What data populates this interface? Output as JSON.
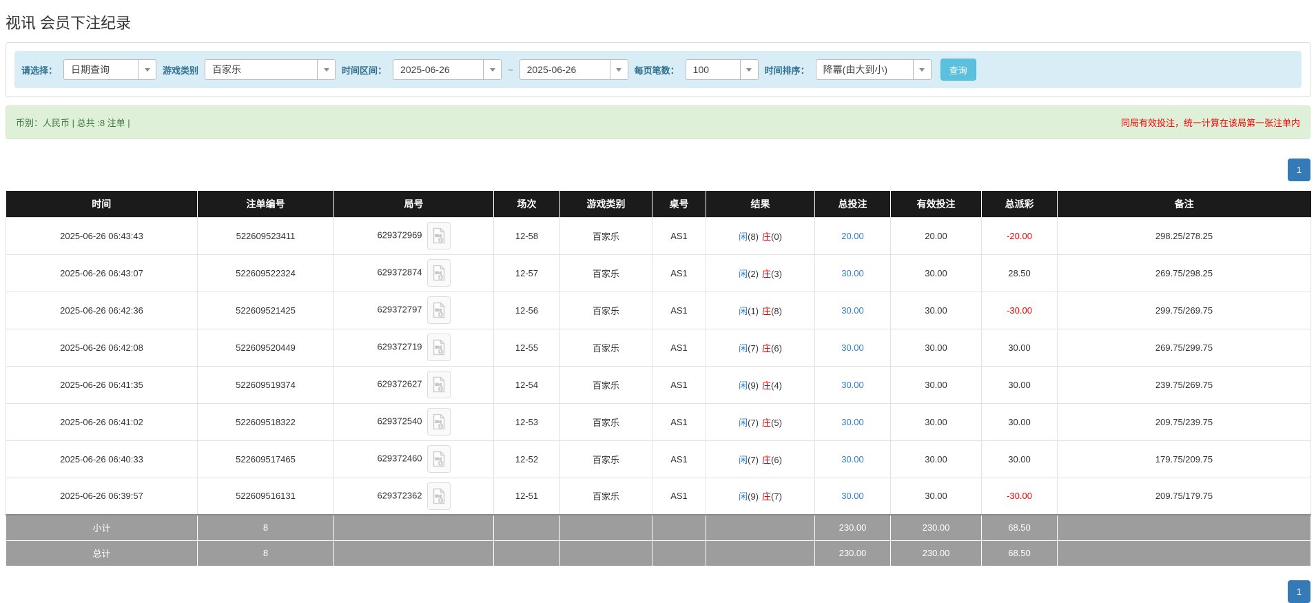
{
  "page": {
    "title": "视讯 会员下注纪录"
  },
  "filters": {
    "select_label": "请选择：",
    "select_value": "日期查询",
    "game_label": "游戏类别",
    "game_value": "百家乐",
    "range_label": "时间区间：",
    "range_from": "2025-06-26",
    "range_tilde": "~",
    "range_to": "2025-06-26",
    "page_size_label": "每页笔数：",
    "page_size_value": "100",
    "sort_label": "时间排序：",
    "sort_value": "降冪(由大到小)",
    "search_button": "查询"
  },
  "summary": {
    "left": "币别：人民币 | 总共 :8 注单 |",
    "right_notice": "同局有效投注，统一计算在该局第一张注单内"
  },
  "pagination": {
    "page": "1"
  },
  "table": {
    "headers": [
      "时间",
      "注单编号",
      "局号",
      "场次",
      "游戏类别",
      "桌号",
      "结果",
      "总投注",
      "有效投注",
      "总派彩",
      "备注"
    ],
    "rows": [
      {
        "time": "2025-06-26 06:43:43",
        "bet_id": "522609523411",
        "round_id": "629372969",
        "session": "12-58",
        "game": "百家乐",
        "table_no": "AS1",
        "player": "闲",
        "player_score": "(8)",
        "banker": "庄",
        "banker_score": "(0)",
        "total_bet": "20.00",
        "valid_bet": "20.00",
        "payout": "-20.00",
        "remark": "298.25/278.25"
      },
      {
        "time": "2025-06-26 06:43:07",
        "bet_id": "522609522324",
        "round_id": "629372874",
        "session": "12-57",
        "game": "百家乐",
        "table_no": "AS1",
        "player": "闲",
        "player_score": "(2)",
        "banker": "庄",
        "banker_score": "(3)",
        "total_bet": "30.00",
        "valid_bet": "30.00",
        "payout": "28.50",
        "remark": "269.75/298.25"
      },
      {
        "time": "2025-06-26 06:42:36",
        "bet_id": "522609521425",
        "round_id": "629372797",
        "session": "12-56",
        "game": "百家乐",
        "table_no": "AS1",
        "player": "闲",
        "player_score": "(1)",
        "banker": "庄",
        "banker_score": "(8)",
        "total_bet": "30.00",
        "valid_bet": "30.00",
        "payout": "-30.00",
        "remark": "299.75/269.75"
      },
      {
        "time": "2025-06-26 06:42:08",
        "bet_id": "522609520449",
        "round_id": "629372719",
        "session": "12-55",
        "game": "百家乐",
        "table_no": "AS1",
        "player": "闲",
        "player_score": "(7)",
        "banker": "庄",
        "banker_score": "(6)",
        "total_bet": "30.00",
        "valid_bet": "30.00",
        "payout": "30.00",
        "remark": "269.75/299.75"
      },
      {
        "time": "2025-06-26 06:41:35",
        "bet_id": "522609519374",
        "round_id": "629372627",
        "session": "12-54",
        "game": "百家乐",
        "table_no": "AS1",
        "player": "闲",
        "player_score": "(9)",
        "banker": "庄",
        "banker_score": "(4)",
        "total_bet": "30.00",
        "valid_bet": "30.00",
        "payout": "30.00",
        "remark": "239.75/269.75"
      },
      {
        "time": "2025-06-26 06:41:02",
        "bet_id": "522609518322",
        "round_id": "629372540",
        "session": "12-53",
        "game": "百家乐",
        "table_no": "AS1",
        "player": "闲",
        "player_score": "(7)",
        "banker": "庄",
        "banker_score": "(5)",
        "total_bet": "30.00",
        "valid_bet": "30.00",
        "payout": "30.00",
        "remark": "209.75/239.75"
      },
      {
        "time": "2025-06-26 06:40:33",
        "bet_id": "522609517465",
        "round_id": "629372460",
        "session": "12-52",
        "game": "百家乐",
        "table_no": "AS1",
        "player": "闲",
        "player_score": "(7)",
        "banker": "庄",
        "banker_score": "(6)",
        "total_bet": "30.00",
        "valid_bet": "30.00",
        "payout": "30.00",
        "remark": "179.75/209.75"
      },
      {
        "time": "2025-06-26 06:39:57",
        "bet_id": "522609516131",
        "round_id": "629372362",
        "session": "12-51",
        "game": "百家乐",
        "table_no": "AS1",
        "player": "闲",
        "player_score": "(9)",
        "banker": "庄",
        "banker_score": "(7)",
        "total_bet": "30.00",
        "valid_bet": "30.00",
        "payout": "-30.00",
        "remark": "209.75/179.75"
      }
    ],
    "subtotal": {
      "label": "小计",
      "count": "8",
      "total_bet": "230.00",
      "valid_bet": "230.00",
      "payout": "68.50"
    },
    "total": {
      "label": "总计",
      "count": "8",
      "total_bet": "230.00",
      "valid_bet": "230.00",
      "payout": "68.50"
    }
  },
  "colors": {
    "link_blue": "#2d7bd4",
    "banker_red": "#e60000",
    "negative_red": "#ff0000",
    "notice_red": "#ff0000",
    "header_bg": "#1b1b1b",
    "footer_bg": "#9d9d9d",
    "filter_bg": "#d9edf7",
    "filter_label": "#31708f",
    "summary_bg": "#dff0d8",
    "summary_text": "#3c763d",
    "search_button_bg": "#5bc0de",
    "pagination_active_bg": "#337ab7"
  }
}
